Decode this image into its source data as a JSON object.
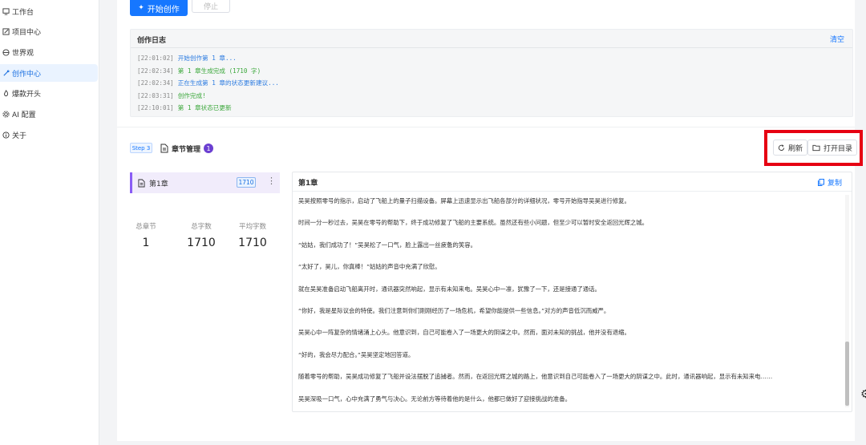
{
  "sidebar": {
    "items": [
      {
        "label": "工作台",
        "icon": "workbench-icon"
      },
      {
        "label": "项目中心",
        "icon": "edit-icon"
      },
      {
        "label": "世界观",
        "icon": "world-icon"
      },
      {
        "label": "创作中心",
        "icon": "magic-icon",
        "active": true
      },
      {
        "label": "爆款开头",
        "icon": "fire-icon"
      },
      {
        "label": "AI 配置",
        "icon": "gear-icon"
      },
      {
        "label": "关于",
        "icon": "info-icon"
      }
    ]
  },
  "top_buttons": {
    "start": "开始创作",
    "stop": "停止"
  },
  "log": {
    "title": "创作日志",
    "clear_label": "清空",
    "entries": [
      {
        "time": "[22:01:02]",
        "text": "开始创作第 1 章...",
        "level": "info"
      },
      {
        "time": "[22:02:34]",
        "text": "第 1 章生成完成 (1710 字)",
        "level": "ok"
      },
      {
        "time": "[22:02:34]",
        "text": "正在生成第 1 章的状态更新建议...",
        "level": "info"
      },
      {
        "time": "[22:03:31]",
        "text": "创作完成!",
        "level": "ok"
      },
      {
        "time": "[22:10:01]",
        "text": "第 1 章状态已更新",
        "level": "ok"
      }
    ]
  },
  "step": {
    "badge": "Step 3",
    "title": "章节管理",
    "count": "1"
  },
  "toolbar": {
    "refresh_label": "刷新",
    "open_dir_label": "打开目录",
    "highlight_color": "#e60012"
  },
  "chapters": [
    {
      "name": "第1章",
      "word_count": "1710"
    }
  ],
  "stats": [
    {
      "label": "总章节",
      "value": "1"
    },
    {
      "label": "总字数",
      "value": "1710"
    },
    {
      "label": "平均字数",
      "value": "1710"
    }
  ],
  "content": {
    "title": "第1章",
    "copy_label": "复制",
    "paragraphs": [
      "吴昊按照零号的指示，启动了飞船上的量子扫描设备。屏幕上迅速显示出飞船各部分的详细状况，零号开始指导吴昊进行修复。",
      "时间一分一秒过去，吴昊在零号的帮助下，终于成功修复了飞船的主要系统。虽然还有些小问题，但至少可以暂时安全返回光辉之城。",
      "“姑姑，我们成功了！”吴昊松了一口气，脸上露出一丝疲惫的笑容。",
      "“太好了，昊儿，你真棒！”姑姑的声音中充满了欣慰。",
      "就在吴昊准备启动飞船离开时，通讯器突然响起，显示有未知来电。吴昊心中一凛，犹豫了一下，还是接通了通话。",
      "“你好，我是星际议会的特使。我们注意到你们刚刚经历了一场危机，希望你能提供一些信息。”对方的声音低沉而威严。",
      "吴昊心中一阵复杂的情绪涌上心头。他意识到，自己可能卷入了一场更大的阴谋之中。然而，面对未知的挑战，他并没有退缩。",
      "“好的，我会尽力配合。”吴昊坚定地回答道。",
      "随着零号的帮助，吴昊成功修复了飞船并设法摆脱了追捕者。然而，在返回光辉之城的路上，他意识到自己可能卷入了一场更大的阴谋之中。此时，通讯器响起，显示有未知来电……",
      "吴昊深吸一口气，心中充满了勇气与决心。无论前方等待着他的是什么，他都已做好了迎接挑战的准备。"
    ]
  }
}
